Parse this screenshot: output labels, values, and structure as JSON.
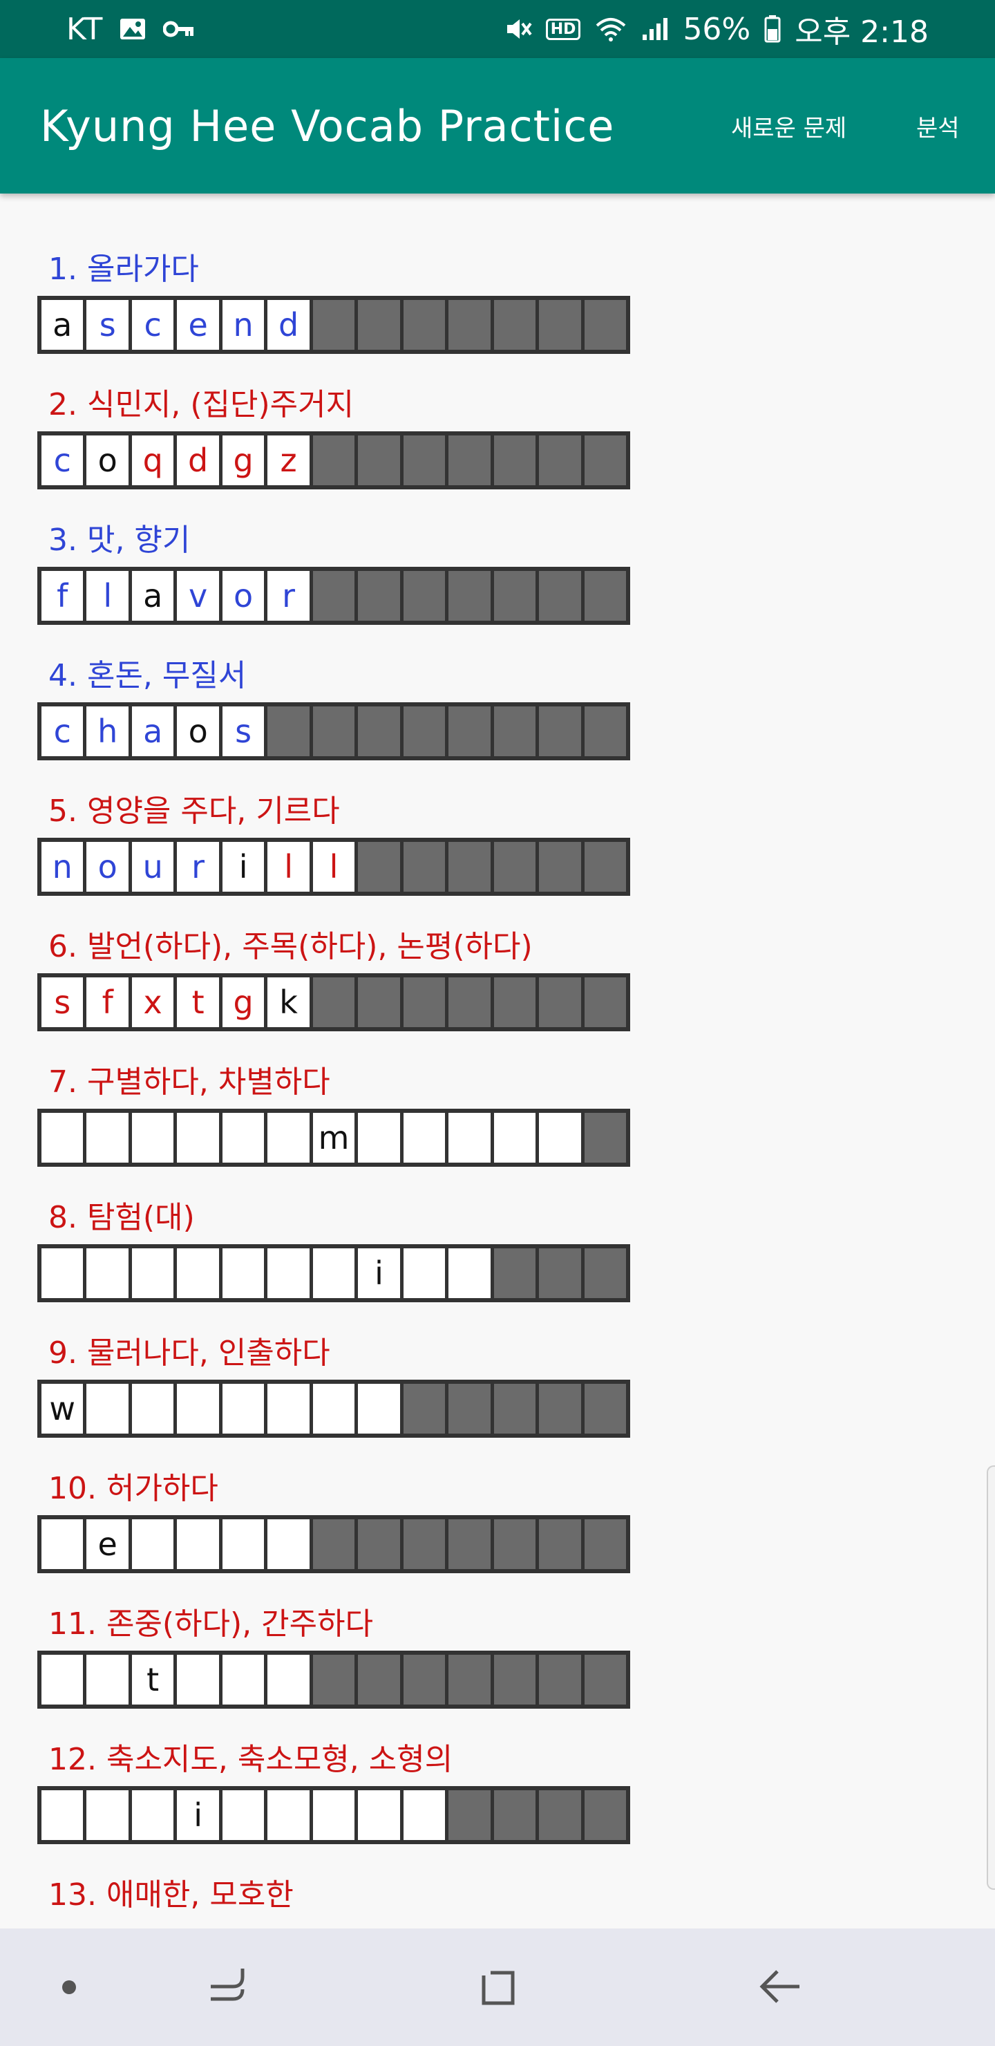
{
  "status": {
    "carrier": "KT",
    "battery": "56%",
    "time": "오후 2:18",
    "hd": "HD"
  },
  "app": {
    "title": "Kyung Hee Vocab Practice",
    "new_question": "새로운 문제",
    "analysis": "분석"
  },
  "colors": {
    "status_bar": "#00695c",
    "app_bar": "#00897b",
    "correct_blue": "#2f45d6",
    "wrong_red": "#cc1414",
    "inactive_cell": "#6b6b6b"
  },
  "questions": [
    {
      "label": "1. 올라가다",
      "color": "blue",
      "letters": [
        "a",
        "s",
        "c",
        "e",
        "n",
        "d"
      ],
      "letter_colors": [
        "black",
        "blue",
        "blue",
        "blue",
        "blue",
        "blue"
      ],
      "active": 6
    },
    {
      "label": "2. 식민지, (집단)주거지",
      "color": "red",
      "letters": [
        "c",
        "o",
        "q",
        "d",
        "g",
        "z"
      ],
      "letter_colors": [
        "blue",
        "black",
        "red",
        "red",
        "red",
        "red"
      ],
      "active": 6
    },
    {
      "label": "3. 맛, 향기",
      "color": "blue",
      "letters": [
        "f",
        "l",
        "a",
        "v",
        "o",
        "r"
      ],
      "letter_colors": [
        "blue",
        "blue",
        "black",
        "blue",
        "blue",
        "blue"
      ],
      "active": 6
    },
    {
      "label": "4. 혼돈, 무질서",
      "color": "blue",
      "letters": [
        "c",
        "h",
        "a",
        "o",
        "s"
      ],
      "letter_colors": [
        "blue",
        "blue",
        "blue",
        "black",
        "blue"
      ],
      "active": 5
    },
    {
      "label": "5. 영양을 주다, 기르다",
      "color": "red",
      "letters": [
        "n",
        "o",
        "u",
        "r",
        "i",
        "l",
        "l"
      ],
      "letter_colors": [
        "blue",
        "blue",
        "blue",
        "blue",
        "black",
        "red",
        "red"
      ],
      "active": 7
    },
    {
      "label": "6. 발언(하다), 주목(하다), 논평(하다)",
      "color": "red",
      "letters": [
        "s",
        "f",
        "x",
        "t",
        "g",
        "k"
      ],
      "letter_colors": [
        "red",
        "red",
        "red",
        "red",
        "red",
        "black"
      ],
      "active": 6
    },
    {
      "label": "7. 구별하다, 차별하다",
      "color": "red",
      "letters": [
        "",
        "",
        "",
        "",
        "",
        "",
        "m",
        "",
        "",
        "",
        "",
        ""
      ],
      "letter_colors": [
        "black",
        "black",
        "black",
        "black",
        "black",
        "black",
        "black",
        "black",
        "black",
        "black",
        "black",
        "black"
      ],
      "active": 12
    },
    {
      "label": "8. 탐험(대)",
      "color": "red",
      "letters": [
        "",
        "",
        "",
        "",
        "",
        "",
        "",
        "i",
        "",
        ""
      ],
      "letter_colors": [
        "black",
        "black",
        "black",
        "black",
        "black",
        "black",
        "black",
        "black",
        "black",
        "black"
      ],
      "active": 10
    },
    {
      "label": "9. 물러나다, 인출하다",
      "color": "red",
      "letters": [
        "w",
        "",
        "",
        "",
        "",
        "",
        "",
        "",
        ""
      ],
      "letter_colors": [
        "black",
        "black",
        "black",
        "black",
        "black",
        "black",
        "black",
        "black",
        "black"
      ],
      "active": 8
    },
    {
      "label": "10. 허가하다",
      "color": "red",
      "letters": [
        "",
        "e",
        "",
        "",
        "",
        "",
        ""
      ],
      "letter_colors": [
        "black",
        "black",
        "black",
        "black",
        "black",
        "black"
      ],
      "active": 6
    },
    {
      "label": "11. 존중(하다), 간주하다",
      "color": "red",
      "letters": [
        "",
        "",
        "t",
        "",
        "",
        ""
      ],
      "letter_colors": [
        "black",
        "black",
        "black",
        "black",
        "black",
        "black"
      ],
      "active": 6
    },
    {
      "label": "12. 축소지도, 축소모형, 소형의",
      "color": "red",
      "letters": [
        "",
        "",
        "",
        "i",
        "",
        "",
        "",
        "",
        "",
        ""
      ],
      "letter_colors": [
        "black",
        "black",
        "black",
        "black",
        "black",
        "black",
        "black",
        "black",
        "black",
        "black"
      ],
      "active": 9
    },
    {
      "label": "13. 애매한, 모호한",
      "color": "red",
      "letters": [],
      "letter_colors": [],
      "active": 0
    }
  ],
  "nav": {
    "recent_icon": "recent-apps-icon",
    "home_icon": "home-icon",
    "back_icon": "back-arrow-icon"
  }
}
